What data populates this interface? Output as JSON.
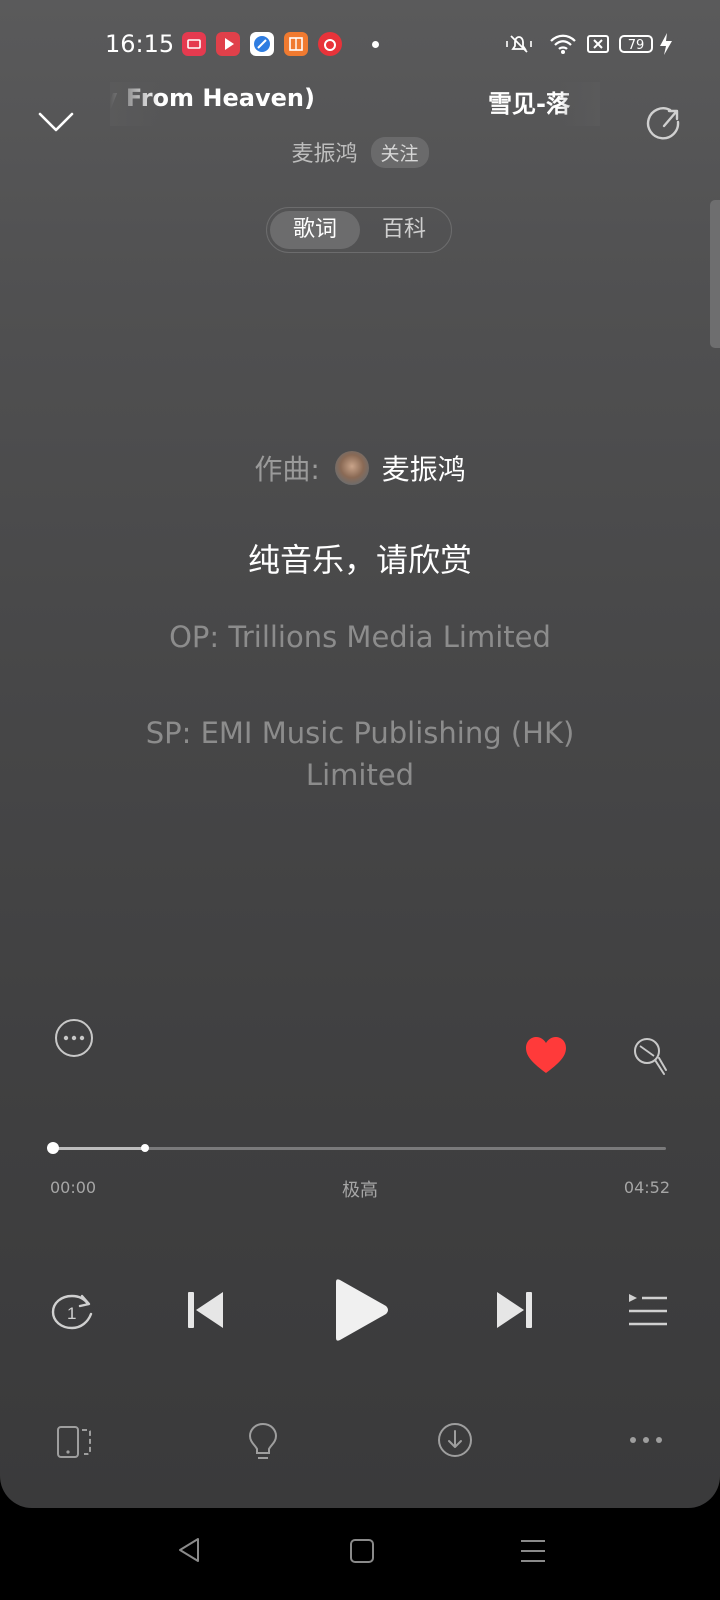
{
  "status_bar": {
    "time": "16:15",
    "notification_icons": [
      "screen-record-icon",
      "video-app-icon",
      "browser-app-icon",
      "reader-app-icon",
      "netease-music-icon"
    ],
    "battery": "79",
    "icons": [
      "mute-icon",
      "wifi-icon",
      "sim-blocked-icon",
      "battery-icon",
      "charging-icon"
    ]
  },
  "header": {
    "title_part1": "ry From Heaven)",
    "title_part2": "雪见-落",
    "artist": "麦振鸿",
    "follow_label": "关注"
  },
  "tabs": {
    "lyrics": "歌词",
    "wiki": "百科"
  },
  "lyrics": {
    "composer_label": "作曲:",
    "composer_name": "麦振鸿",
    "main_line": "纯音乐，请欣赏",
    "op_line": "OP: Trillions Media Limited",
    "sp_line": "SP: EMI Music Publishing (HK) Limited"
  },
  "player": {
    "current_time": "00:00",
    "quality": "极高",
    "total_time": "04:52",
    "progress": 0.0,
    "buffered": 0.15,
    "liked": true,
    "like_color": "#ff3a3a"
  }
}
